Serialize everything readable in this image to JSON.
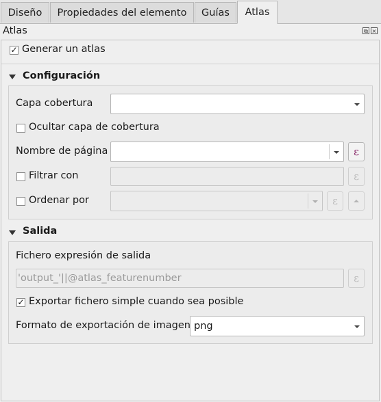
{
  "tabs": [
    {
      "label": "Diseño"
    },
    {
      "label": "Propiedades del elemento"
    },
    {
      "label": "Guías"
    },
    {
      "label": "Atlas",
      "active": true
    }
  ],
  "dock": {
    "title": "Atlas"
  },
  "generate": {
    "label": "Generar un atlas",
    "checked": true,
    "mark": "✓"
  },
  "config": {
    "title": "Configuración",
    "coverage_label": "Capa cobertura",
    "coverage_value": "",
    "hide_coverage_label": "Ocultar capa de cobertura",
    "hide_coverage_checked": false,
    "page_name_label": "Nombre de página",
    "page_name_value": "",
    "filter_label": "Filtrar con",
    "filter_checked": false,
    "filter_value": "",
    "sort_label": "Ordenar por",
    "sort_checked": false,
    "sort_value": "",
    "expression_glyph": "ε"
  },
  "output": {
    "title": "Salida",
    "filename_label": "Fichero expresión de salida",
    "filename_value": "'output_'||@atlas_featurenumber",
    "single_file_label": "Exportar fichero simple cuando sea posible",
    "single_file_checked": true,
    "single_file_mark": "✓",
    "image_format_label": "Formato de exportación de imagen",
    "image_format_value": "png"
  },
  "icons": {
    "float": "float-icon",
    "close": "close-icon",
    "expression": "expression-icon",
    "dropdown": "chevron-down-icon",
    "collapse": "collapse-triangle-icon",
    "sort": "sort-ascending-icon"
  }
}
